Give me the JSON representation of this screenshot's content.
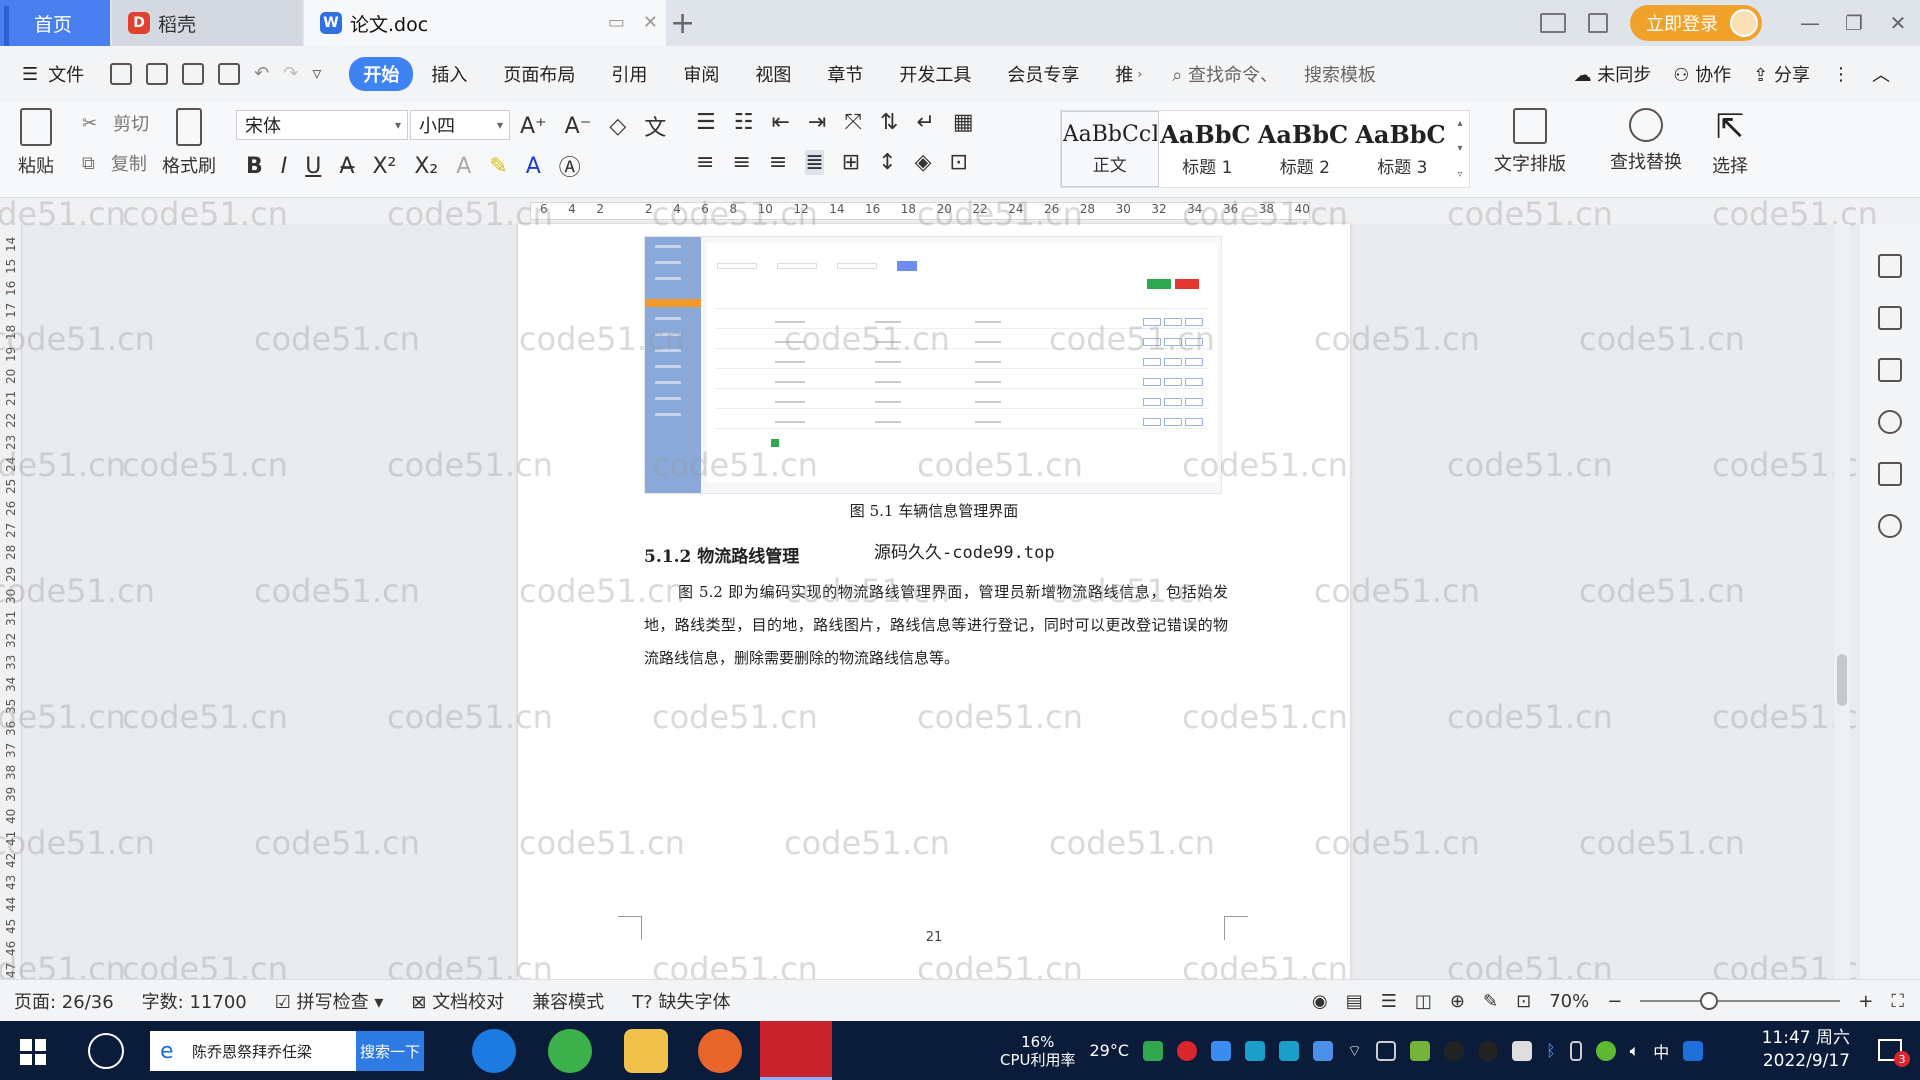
{
  "tabs": {
    "home": "首页",
    "daoke": "稻壳",
    "doc": "论文.doc"
  },
  "header": {
    "login": "立即登录"
  },
  "menu": {
    "file": "文件",
    "items": [
      "开始",
      "插入",
      "页面布局",
      "引用",
      "审阅",
      "视图",
      "章节",
      "开发工具",
      "会员专享",
      "推"
    ],
    "search_command": "查找命令、",
    "search_template": "搜索模板",
    "sync": "未同步",
    "collab": "协作",
    "share": "分享"
  },
  "ribbon": {
    "paste": "粘贴",
    "cut": "剪切",
    "copy": "复制",
    "format_painter": "格式刷",
    "font_name": "宋体",
    "font_size": "小四",
    "styles": [
      {
        "sample": "AaBbCcI",
        "name": "正文"
      },
      {
        "sample": "AaBbC",
        "name": "标题 1"
      },
      {
        "sample": "AaBbC",
        "name": "标题 2"
      },
      {
        "sample": "AaBbC",
        "name": "标题 3"
      }
    ],
    "text_layout": "文字排版",
    "find_replace": "查找替换",
    "select": "选择"
  },
  "ruler": {
    "h_ticks": [
      "6",
      "4",
      "2",
      "",
      "2",
      "4",
      "6",
      "8",
      "10",
      "12",
      "14",
      "16",
      "18",
      "20",
      "22",
      "24",
      "26",
      "28",
      "30",
      "32",
      "34",
      "36",
      "38",
      "40"
    ],
    "v_ticks": [
      "14",
      "15",
      "16",
      "17",
      "18",
      "19",
      "20",
      "21",
      "22",
      "23",
      "24",
      "25",
      "26",
      "27",
      "28",
      "29",
      "30",
      "31",
      "32",
      "33",
      "34",
      "35",
      "36",
      "37",
      "38",
      "39",
      "40",
      "41",
      "42",
      "43",
      "44",
      "45",
      "46",
      "47"
    ]
  },
  "document": {
    "caption": "图 5.1  车辆信息管理界面",
    "heading": "5.1.2  物流路线管理",
    "overlay_note": "源码久久-code99.top",
    "paragraph": "图 5.2 即为编码实现的物流路线管理界面，管理员新增物流路线信息，包括始发地，路线类型，目的地，路线图片，路线信息等进行登记，同时可以更改登记错误的物流路线信息，删除需要删除的物流路线信息等。",
    "page_number": "21"
  },
  "watermark": "code51.cn",
  "status": {
    "page": "页面: 26/36",
    "words": "字数: 11700",
    "spell": "拼写检查",
    "proof": "文档校对",
    "compat": "兼容模式",
    "missing_font": "缺失字体",
    "zoom": "70%"
  },
  "taskbar": {
    "search_text": "陈乔恩祭拜乔任梁",
    "search_btn": "搜索一下",
    "cpu": "16%",
    "cpu_label": "CPU利用率",
    "temp": "29°C",
    "ime": "中",
    "time": "11:47 周六",
    "date": "2022/9/17",
    "notif_count": "3"
  },
  "colors": {
    "accent": "#3e83f2",
    "login": "#f0a22b",
    "taskbar": "#0b1b3a"
  }
}
